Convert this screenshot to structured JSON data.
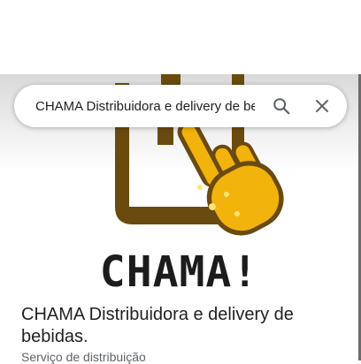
{
  "search": {
    "query": "CHAMA Distribuidora e delivery de bebidas",
    "search_icon": "search-icon",
    "close_icon": "close-icon"
  },
  "hero": {
    "logo_icon": "tapping-hand-phone-logo",
    "brand_word": "CHAMA!"
  },
  "place": {
    "name": "CHAMA Distribuidora e delivery de bebidas.",
    "category": "Serviço de distribuição"
  },
  "colors": {
    "logo_brown": "#6b4a0f",
    "logo_gold": "#f2b40c",
    "text_primary": "#202124",
    "text_secondary": "#5f6368"
  }
}
